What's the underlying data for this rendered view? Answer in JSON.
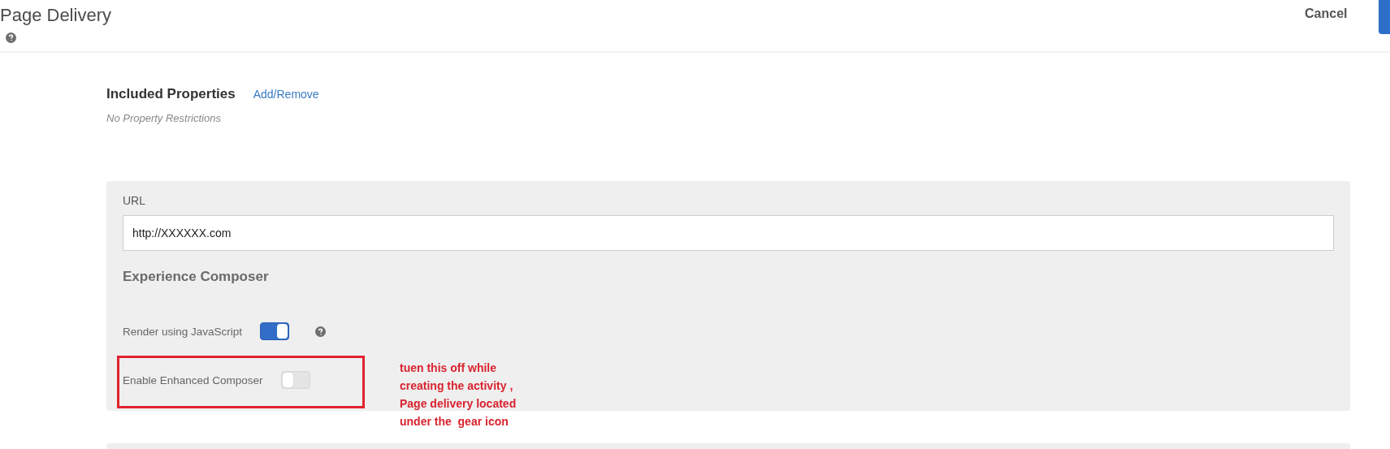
{
  "header": {
    "title": "Page Delivery",
    "cancel": "Cancel"
  },
  "properties": {
    "heading": "Included Properties",
    "link": "Add/Remove",
    "note": "No Property Restrictions"
  },
  "url": {
    "label": "URL",
    "value": "http://XXXXXX.com"
  },
  "composer": {
    "heading": "Experience Composer",
    "settings": [
      {
        "label": "Render using JavaScript",
        "on": true,
        "help": true,
        "highlighted": false
      },
      {
        "label": "Enable Enhanced Composer",
        "on": false,
        "help": false,
        "highlighted": true
      }
    ]
  },
  "annotation": {
    "lines": [
      "tuen this off while",
      "creating the activity ,",
      "Page delivery located",
      "under the  gear icon"
    ]
  }
}
